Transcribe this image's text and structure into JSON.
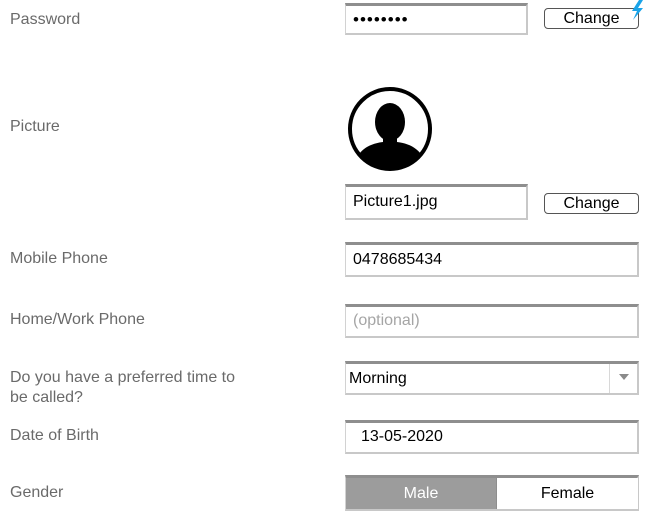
{
  "password": {
    "label": "Password",
    "value": "••••••••",
    "change_label": "Change"
  },
  "picture": {
    "label": "Picture",
    "filename": "Picture1.jpg",
    "change_label": "Change",
    "avatar_icon": "user-silhouette-icon"
  },
  "mobile_phone": {
    "label": "Mobile Phone",
    "value": "0478685434"
  },
  "home_work_phone": {
    "label": "Home/Work Phone",
    "placeholder": "(optional)"
  },
  "preferred_time": {
    "label_line1": "Do you have a preferred time to",
    "label_line2": "be called?",
    "selected": "Morning"
  },
  "date_of_birth": {
    "label": "Date of Birth",
    "value": "13-05-2020"
  },
  "gender": {
    "label": "Gender",
    "options": [
      "Male",
      "Female"
    ],
    "selected": "Male"
  },
  "colors": {
    "field_border_top": "#8e8e8e",
    "label_text": "#6a6a6a",
    "segment_selected": "#9c9c9c",
    "bolt": "#1aa3e8"
  }
}
